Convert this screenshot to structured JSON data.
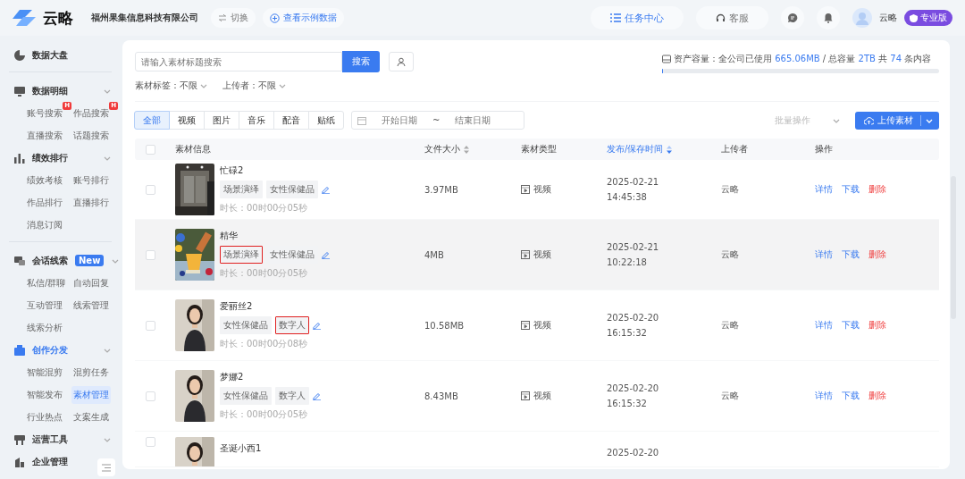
{
  "topbar": {
    "brand": "云略",
    "company": "福州果集信息科技有限公司",
    "switch_button": "切换",
    "demo_button": "查看示例数据",
    "task_button": "任务中心",
    "service_button": "客服",
    "username": "云略",
    "plan_badge": "专业版"
  },
  "sidebar": {
    "sections": [
      {
        "label": "数据大盘",
        "collapsible": false,
        "active": false,
        "divider_after": true
      },
      {
        "label": "数据明细",
        "collapsible": true,
        "active": false,
        "divider_after": false,
        "children": [
          {
            "label": "账号搜索",
            "badge": "H",
            "selected": false
          },
          {
            "label": "作品搜索",
            "badge": "H",
            "selected": false
          },
          {
            "label": "直播搜索",
            "selected": false
          },
          {
            "label": "话题搜索",
            "selected": false
          }
        ]
      },
      {
        "label": "绩效排行",
        "collapsible": true,
        "active": false,
        "divider_after": true,
        "children": [
          {
            "label": "绩效考核",
            "selected": false
          },
          {
            "label": "账号排行",
            "selected": false
          },
          {
            "label": "作品排行",
            "selected": false
          },
          {
            "label": "直播排行",
            "selected": false
          },
          {
            "label": "消息订阅",
            "selected": false
          }
        ]
      },
      {
        "label": "会话线索",
        "badge": "New",
        "collapsible": true,
        "active": false,
        "divider_after": false,
        "children": [
          {
            "label": "私信/群聊",
            "selected": false
          },
          {
            "label": "自动回复",
            "selected": false
          },
          {
            "label": "互动管理",
            "selected": false
          },
          {
            "label": "线索管理",
            "selected": false
          },
          {
            "label": "线索分析",
            "selected": false
          }
        ]
      },
      {
        "label": "创作分发",
        "collapsible": true,
        "active": true,
        "divider_after": false,
        "children": [
          {
            "label": "智能混剪",
            "selected": false
          },
          {
            "label": "混剪任务",
            "selected": false
          },
          {
            "label": "智能发布",
            "selected": false
          },
          {
            "label": "素材管理",
            "selected": true
          },
          {
            "label": "行业热点",
            "selected": false
          },
          {
            "label": "文案生成",
            "selected": false
          }
        ]
      },
      {
        "label": "运营工具",
        "collapsible": true,
        "active": false,
        "divider_after": false
      },
      {
        "label": "企业管理",
        "collapsible": false,
        "active": false,
        "divider_after": false
      }
    ]
  },
  "search": {
    "placeholder": "请输入素材标题搜索",
    "button": "搜索"
  },
  "filters": [
    {
      "label": "素材标签：",
      "value": "不限"
    },
    {
      "label": "上传者：",
      "value": "不限"
    }
  ],
  "storage": {
    "segments": [
      {
        "text": "资产容量：全公司已使用 ",
        "highlight": false
      },
      {
        "text": "665.06MB",
        "highlight": true
      },
      {
        "text": " / 总容量 ",
        "highlight": false
      },
      {
        "text": "2TB",
        "highlight": true
      },
      {
        "text": " 共 ",
        "highlight": false
      },
      {
        "text": "74",
        "highlight": true
      },
      {
        "text": " 条内容",
        "highlight": false
      }
    ],
    "level": 0.003
  },
  "tabs": [
    {
      "label": "全部",
      "selected": true
    },
    {
      "label": "视频",
      "selected": false
    },
    {
      "label": "图片",
      "selected": false
    },
    {
      "label": "音乐",
      "selected": false
    },
    {
      "label": "配音",
      "selected": false
    },
    {
      "label": "贴纸",
      "selected": false
    }
  ],
  "date_range": {
    "start_placeholder": "开始日期",
    "separator": "~",
    "end_placeholder": "结束日期"
  },
  "batch_select": {
    "placeholder": "批量操作",
    "disabled": true
  },
  "upload_button": "上传素材",
  "table": {
    "select_all_checked": false,
    "columns": [
      {
        "label": "素材信息",
        "sortable": false,
        "sorted": false
      },
      {
        "label": "文件大小",
        "sortable": true,
        "sorted": false
      },
      {
        "label": "素材类型",
        "sortable": false,
        "sorted": false
      },
      {
        "label": "发布/保存时间",
        "sortable": true,
        "sorted": true
      },
      {
        "label": "上传者",
        "sortable": false,
        "sorted": false
      },
      {
        "label": "操作",
        "sortable": false,
        "sorted": false
      }
    ],
    "rows": [
      {
        "checked": false,
        "title": "忙碌2",
        "tags": [
          {
            "label": "场景演绎",
            "highlighted": false
          },
          {
            "label": "女性保健品",
            "highlighted": false
          }
        ],
        "duration": "时长：00时00分05秒",
        "size": "3.97MB",
        "type": "视频",
        "date": "2025-02-21",
        "time": "14:45:38",
        "uploader": "云略",
        "hovered": false,
        "actions": [
          {
            "label": "详情",
            "kind": "link"
          },
          {
            "label": "下载",
            "kind": "link"
          },
          {
            "label": "删除",
            "kind": "danger"
          }
        ]
      },
      {
        "checked": false,
        "title": "精华",
        "tags": [
          {
            "label": "场景演绎",
            "highlighted": true
          },
          {
            "label": "女性保健品",
            "highlighted": false
          }
        ],
        "duration": "时长：00时00分05秒",
        "size": "4MB",
        "type": "视频",
        "date": "2025-02-21",
        "time": "10:22:18",
        "uploader": "云略",
        "hovered": true,
        "actions": [
          {
            "label": "详情",
            "kind": "link"
          },
          {
            "label": "下载",
            "kind": "link"
          },
          {
            "label": "删除",
            "kind": "danger"
          }
        ]
      },
      {
        "checked": false,
        "title": "爱丽丝2",
        "tags": [
          {
            "label": "女性保健品",
            "highlighted": false
          },
          {
            "label": "数字人",
            "highlighted": true
          }
        ],
        "duration": "时长：00时00分08秒",
        "size": "10.58MB",
        "type": "视频",
        "date": "2025-02-20",
        "time": "16:15:32",
        "uploader": "云略",
        "hovered": false,
        "actions": [
          {
            "label": "详情",
            "kind": "link"
          },
          {
            "label": "下载",
            "kind": "link"
          },
          {
            "label": "删除",
            "kind": "danger"
          }
        ]
      },
      {
        "checked": false,
        "title": "梦娜2",
        "tags": [
          {
            "label": "女性保健品",
            "highlighted": false
          },
          {
            "label": "数字人",
            "highlighted": false
          }
        ],
        "duration": "时长：00时00分05秒",
        "size": "8.43MB",
        "type": "视频",
        "date": "2025-02-20",
        "time": "16:15:32",
        "uploader": "云略",
        "hovered": false,
        "actions": [
          {
            "label": "详情",
            "kind": "link"
          },
          {
            "label": "下载",
            "kind": "link"
          },
          {
            "label": "删除",
            "kind": "danger"
          }
        ]
      },
      {
        "checked": false,
        "title": "圣诞小西1",
        "date": "2025-02-20",
        "hovered": false
      }
    ]
  }
}
